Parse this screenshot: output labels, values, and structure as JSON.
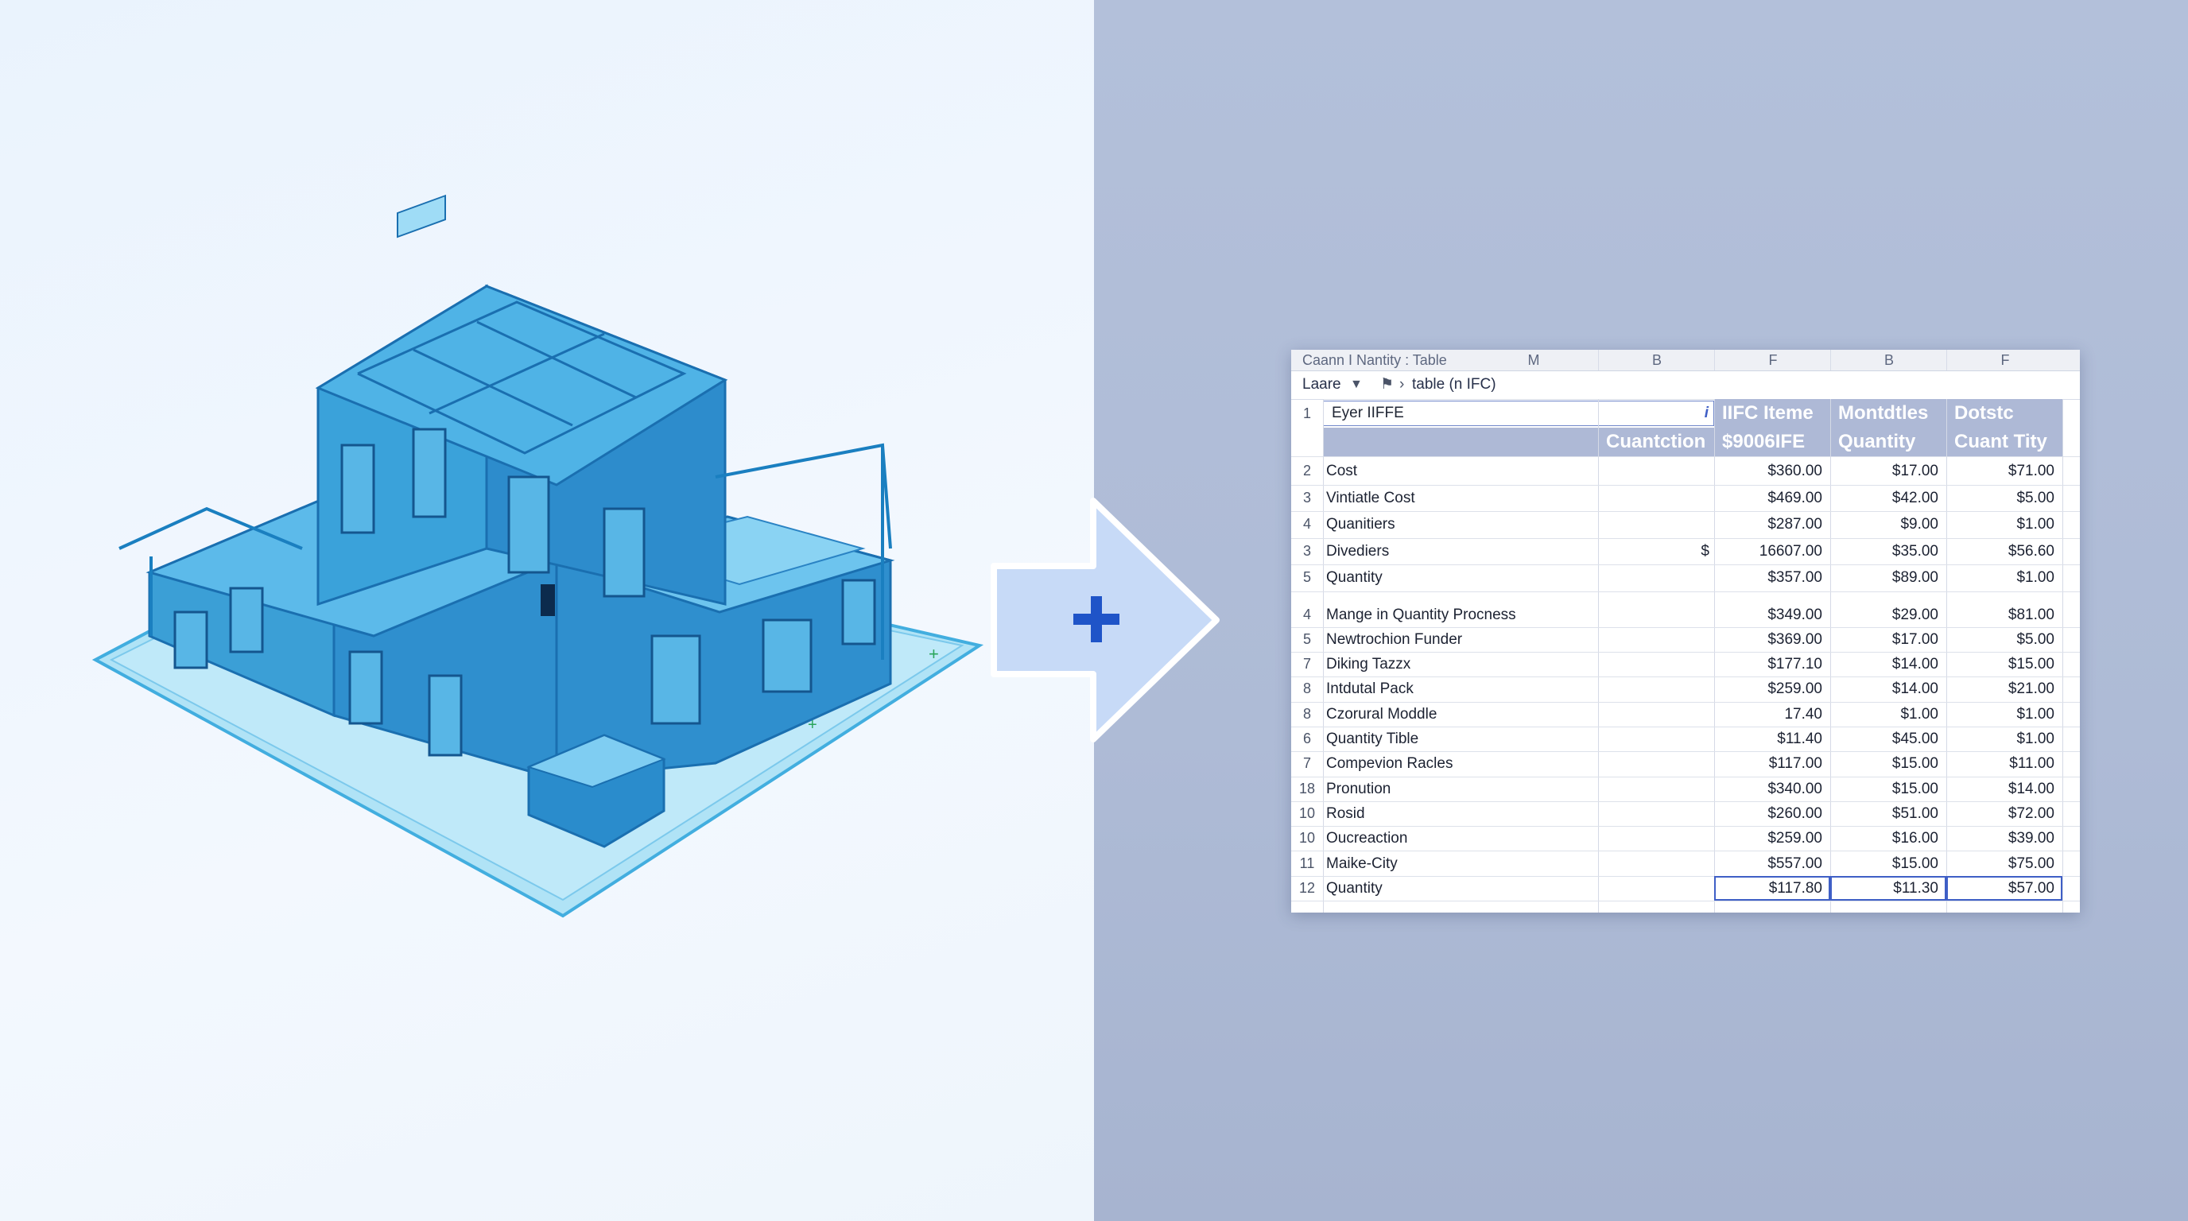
{
  "sheet": {
    "title": "Caann I Nantity : Table",
    "column_letters": [
      "M",
      "B",
      "F",
      "B",
      "F"
    ],
    "toolbar": {
      "left_label": "Laare",
      "breadcrumb": "table (n IFC)"
    },
    "header": {
      "row_number": "1",
      "name_cell": "Eyer IIFFE",
      "info_glyph": "i",
      "col_b": "Cuantction",
      "col_c_line1": "IIFC Iteme",
      "col_c_line2": "$9006IFE",
      "col_d_line1": "Montdtles",
      "col_d_line2": "Quantity",
      "col_e_line1": "Dotstc",
      "col_e_line2": "Cuant Tity"
    },
    "rows": [
      {
        "num": "2",
        "label": "Cost",
        "b": "",
        "c": "$360.00",
        "d": "$17.00",
        "e": "$71.00"
      },
      {
        "num": "3",
        "label": "Vintiatle Cost",
        "b": "",
        "c": "$469.00",
        "d": "$42.00",
        "e": "$5.00"
      },
      {
        "num": "4",
        "label": "Quanitiers",
        "b": "",
        "c": "$287.00",
        "d": "$9.00",
        "e": "$1.00"
      },
      {
        "num": "3",
        "label": "Divediers",
        "b": "$",
        "c": "16607.00",
        "d": "$35.00",
        "e": "$56.60"
      },
      {
        "num": "5",
        "label": "Quantity",
        "b": "",
        "c": "$357.00",
        "d": "$89.00",
        "e": "$1.00"
      },
      {
        "num": "4",
        "label": "Mange in Quantity Procness",
        "b": "",
        "c": "$349.00",
        "d": "$29.00",
        "e": "$81.00"
      },
      {
        "num": "5",
        "label": "Newtrochion Funder",
        "b": "",
        "c": "$369.00",
        "d": "$17.00",
        "e": "$5.00"
      },
      {
        "num": "7",
        "label": "Diking Tazzx",
        "b": "",
        "c": "$177.10",
        "d": "$14.00",
        "e": "$15.00"
      },
      {
        "num": "8",
        "label": "Intdutal Pack",
        "b": "",
        "c": "$259.00",
        "d": "$14.00",
        "e": "$21.00"
      },
      {
        "num": "8",
        "label": "Czorural Moddle",
        "b": "",
        "c": "17.40",
        "d": "$1.00",
        "e": "$1.00"
      },
      {
        "num": "6",
        "label": "Quantity Tible",
        "b": "",
        "c": "$11.40",
        "d": "$45.00",
        "e": "$1.00"
      },
      {
        "num": "7",
        "label": "Compevion Racles",
        "b": "",
        "c": "$117.00",
        "d": "$15.00",
        "e": "$11.00"
      },
      {
        "num": "18",
        "label": "Pronution",
        "b": "",
        "c": "$340.00",
        "d": "$15.00",
        "e": "$14.00"
      },
      {
        "num": "10",
        "label": "Rosid",
        "b": "",
        "c": "$260.00",
        "d": "$51.00",
        "e": "$72.00"
      },
      {
        "num": "10",
        "label": "Oucreaction",
        "b": "",
        "c": "$259.00",
        "d": "$16.00",
        "e": "$39.00"
      },
      {
        "num": "11",
        "label": "Maike-City",
        "b": "",
        "c": "$557.00",
        "d": "$15.00",
        "e": "$75.00"
      },
      {
        "num": "12",
        "label": "Quantity",
        "b": "",
        "c": "$117.80",
        "d": "$11.30",
        "e": "$57.00"
      }
    ]
  },
  "colors": {
    "left_background": "#eef5fc",
    "right_background": "#aebbd6",
    "building": "#3aa6e0",
    "arrow_fill": "#c7daf7",
    "plus_sign": "#1f54c8",
    "header_fill": "#aeb9d6",
    "selection_border": "#3f5fc6"
  },
  "icons": {
    "arrow": "right-arrow-icon",
    "plus": "plus-icon",
    "dropdown": "dropdown-triangle-icon",
    "flag": "flag-icon",
    "chevron": "chevron-right-icon",
    "info": "info-icon"
  }
}
